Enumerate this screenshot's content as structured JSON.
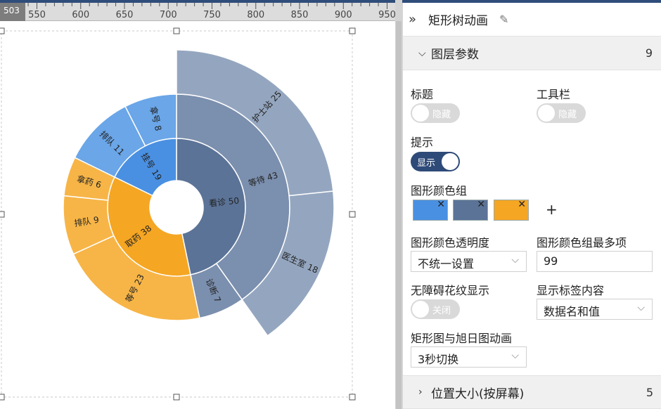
{
  "ruler": {
    "box": "503",
    "ticks": [
      "550",
      "600",
      "650",
      "700",
      "750",
      "800",
      "850",
      "900",
      "950"
    ]
  },
  "panel": {
    "title": "矩形树动画",
    "layer_section": {
      "label": "图层参数",
      "count": "9"
    },
    "title_label": "标题",
    "title_toggle": "隐藏",
    "toolbar_label": "工具栏",
    "toolbar_toggle": "隐藏",
    "tip_label": "提示",
    "tip_toggle": "显示",
    "color_group_label": "图形颜色组",
    "colors": [
      "#4a90e2",
      "#5b7397",
      "#f5a623"
    ],
    "add_symbol": "+",
    "opacity_label": "图形颜色透明度",
    "opacity_value": "不统一设置",
    "max_label": "图形颜色组最多项",
    "max_value": "99",
    "pattern_label": "无障碍花纹显示",
    "pattern_toggle": "关闭",
    "label_content_label": "显示标签内容",
    "label_content_value": "数据名和值",
    "anim_label": "矩形图与旭日图动画",
    "anim_value": "3秒切换",
    "pos_section": {
      "label": "位置大小(按屏幕)",
      "count": "5"
    }
  },
  "chart_data": {
    "type": "sunburst",
    "series": [
      {
        "name": "看诊",
        "value": 50,
        "color": "#5b7397",
        "children": [
          {
            "name": "等待",
            "value": 43,
            "color": "#7b8fae",
            "children": [
              {
                "name": "护士站",
                "value": 25,
                "color": "#94a6bf"
              },
              {
                "name": "医生室",
                "value": 18,
                "color": "#94a6bf"
              }
            ]
          },
          {
            "name": "诊断",
            "value": 7,
            "color": "#7b8fae",
            "children": []
          }
        ]
      },
      {
        "name": "取药",
        "value": 38,
        "color": "#f5a623",
        "children": [
          {
            "name": "等号",
            "value": 23,
            "color": "#f7b547",
            "children": []
          },
          {
            "name": "排队",
            "value": 9,
            "color": "#f7b547",
            "children": []
          },
          {
            "name": "拿药",
            "value": 6,
            "color": "#f7b547",
            "children": []
          }
        ]
      },
      {
        "name": "挂号",
        "value": 19,
        "color": "#4a90e2",
        "children": [
          {
            "name": "排队",
            "value": 11,
            "color": "#6aa6e8",
            "children": []
          },
          {
            "name": "拿号",
            "value": 8,
            "color": "#6aa6e8",
            "children": []
          }
        ]
      }
    ]
  }
}
